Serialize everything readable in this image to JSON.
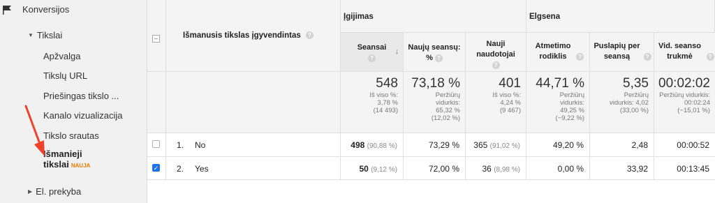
{
  "sidebar": {
    "conversions": "Konversijos",
    "goals": "Tikslai",
    "sub_items": [
      "Apžvalga",
      "Tikslų URL",
      "Priešingas tikslo ...",
      "Kanalo vizualizacija",
      "Tikslo srautas"
    ],
    "active_item_line1": "Išmanieji",
    "active_item_line2": "tikslai",
    "new_badge": "NAUJA",
    "ecommerce": "El. prekyba"
  },
  "table": {
    "dimension_header": "Išmanusis tikslas įgyvendintas",
    "groups": {
      "acquisition": "Įgijimas",
      "behavior": "Elgsena"
    },
    "columns": [
      "Seansai",
      "Naujų seansų: %",
      "Nauji naudotojai",
      "Atmetimo rodiklis",
      "Puslapių per seansą",
      "Vid. seanso trukmė"
    ],
    "totals": [
      {
        "value": "548",
        "l1": "Iš viso %:",
        "l2": "3,78 %",
        "l3": "(14 493)"
      },
      {
        "value": "73,18 %",
        "l1": "Peržiūrų",
        "l2": "vidurkis:",
        "l3": "65,32 %",
        "l4": "(12,02 %)"
      },
      {
        "value": "401",
        "l1": "Iš viso %:",
        "l2": "4,24 %",
        "l3": "(9 467)"
      },
      {
        "value": "44,71 %",
        "l1": "Peržiūrų",
        "l2": "vidurkis:",
        "l3": "49,25 %",
        "l4": "(−9,22 %)"
      },
      {
        "value": "5,35",
        "l1": "Peržiūrų",
        "l2": "vidurkis: 4,02",
        "l3": "(33,00 %)"
      },
      {
        "value": "00:02:02",
        "l1": "Peržiūrų vidurkis:",
        "l2": "00:02:24",
        "l3": "(−15,01 %)"
      }
    ],
    "rows": [
      {
        "index": "1.",
        "label": "No",
        "checked": false,
        "sessions": "498",
        "sessions_pct": "(90,88 %)",
        "new_sessions": "73,29 %",
        "new_users": "365",
        "new_users_pct": "(91,02 %)",
        "bounce": "49,20 %",
        "pages": "2,48",
        "duration": "00:00:52"
      },
      {
        "index": "2.",
        "label": "Yes",
        "checked": true,
        "sessions": "50",
        "sessions_pct": "(9,12 %)",
        "new_sessions": "72,00 %",
        "new_users": "36",
        "new_users_pct": "(8,98 %)",
        "bounce": "0,00 %",
        "pages": "33,92",
        "duration": "00:13:45"
      }
    ]
  },
  "colors": {
    "arrow": "#f0422b",
    "badge": "#f57c00",
    "checkbox_checked": "#1a73e8"
  }
}
